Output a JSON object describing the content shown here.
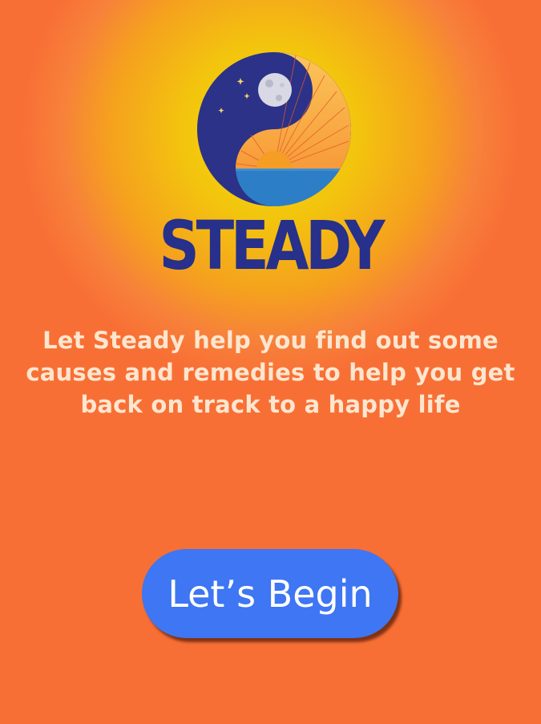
{
  "app": {
    "brand_name": "STEADY",
    "logo_icon": "yin-yang-moon-sun-icon"
  },
  "intro": {
    "tagline": "Let Steady help you find out some causes and remedies to help you get back on track to a happy life"
  },
  "actions": {
    "begin_label": "Let’s Begin"
  },
  "colors": {
    "background": "#f86f35",
    "glow": "#f2dc0c",
    "brand_navy": "#27308a",
    "button_blue": "#3e76f3",
    "tagline_text": "#fde6cf"
  }
}
